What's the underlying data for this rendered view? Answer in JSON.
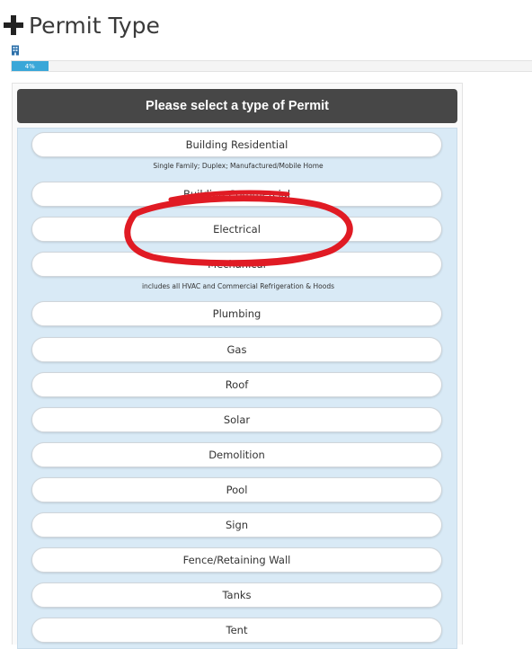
{
  "page": {
    "title": "Permit Type",
    "progress_label": "4%",
    "progress_value": 0.04
  },
  "panel": {
    "header": "Please select a type of Permit",
    "options": [
      {
        "label": "Building Residential",
        "note": "Single Family; Duplex; Manufactured/Mobile Home"
      },
      {
        "label": "Building Commercial"
      },
      {
        "label": "Electrical"
      },
      {
        "label": "Mechanical",
        "note": "includes all HVAC and Commercial Refrigeration & Hoods"
      },
      {
        "label": "Plumbing"
      },
      {
        "label": "Gas"
      },
      {
        "label": "Roof"
      },
      {
        "label": "Solar"
      },
      {
        "label": "Demolition"
      },
      {
        "label": "Pool"
      },
      {
        "label": "Sign"
      },
      {
        "label": "Fence/Retaining Wall"
      },
      {
        "label": "Tanks"
      },
      {
        "label": "Tent"
      }
    ]
  },
  "colors": {
    "header_bg": "#474747",
    "list_bg": "#d9eaf6",
    "progress_fill": "#3aa7d8",
    "annotation": "#e01b24"
  },
  "icons": {
    "title_icon": "plus-icon",
    "sub_icon": "building-icon"
  }
}
